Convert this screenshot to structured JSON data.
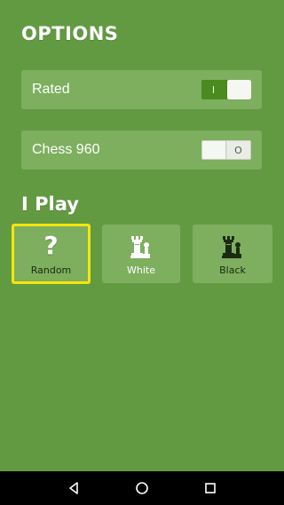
{
  "header": {
    "title": "OPTIONS"
  },
  "options": [
    {
      "label": "Rated",
      "state": "on",
      "state_text": "I"
    },
    {
      "label": "Chess 960",
      "state": "off",
      "state_text": "O"
    }
  ],
  "play": {
    "title": "I Play",
    "selected": "Random",
    "choices": [
      {
        "label": "Random",
        "icon": "question-mark-icon"
      },
      {
        "label": "White",
        "icon": "white-rook-pawn-icon"
      },
      {
        "label": "Black",
        "icon": "black-rook-pawn-icon"
      }
    ]
  },
  "navbar": {
    "icons": [
      "back-triangle-icon",
      "home-circle-icon",
      "recents-square-icon"
    ]
  },
  "colors": {
    "background": "#629a42",
    "panel": "#7daf5f",
    "toggle_on": "#4a8a1e",
    "selected_border": "#f5e60a"
  }
}
